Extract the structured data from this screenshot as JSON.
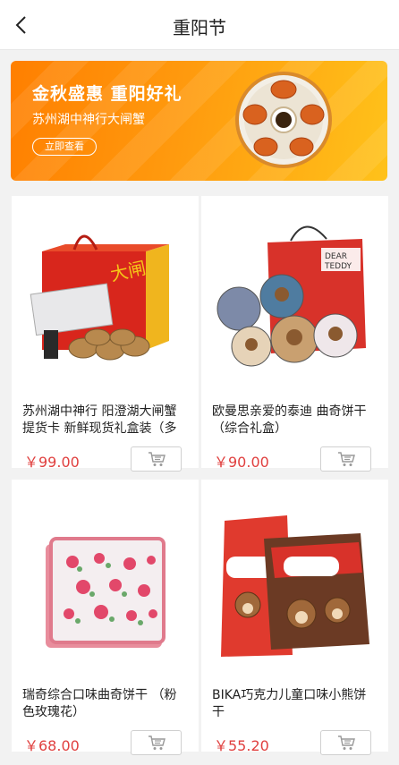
{
  "header": {
    "title": "重阳节",
    "back_icon": "chevron-left-icon"
  },
  "banner": {
    "headline": "金秋盛惠  重阳好礼",
    "subtitle": "苏州湖中神行大闸蟹",
    "button_label": "立即查看",
    "colors": {
      "from": "#ff7f00",
      "to": "#ffc21a"
    }
  },
  "products": [
    {
      "title": "苏州湖中神行 阳澄湖大闸蟹提货卡 新鲜现货礼盒装（多",
      "price": "￥99.00",
      "cart_icon": "cart-icon"
    },
    {
      "title": "欧曼思亲爱的泰迪 曲奇饼干（综合礼盒）",
      "price": "￥90.00",
      "cart_icon": "cart-icon"
    },
    {
      "title": "瑞奇综合口味曲奇饼干 （粉色玫瑰花）",
      "price": "￥68.00",
      "cart_icon": "cart-icon"
    },
    {
      "title": "BIKA巧克力儿童口味小熊饼干",
      "price": "￥55.20",
      "cart_icon": "cart-icon"
    }
  ],
  "accent_color": "#e0403f"
}
